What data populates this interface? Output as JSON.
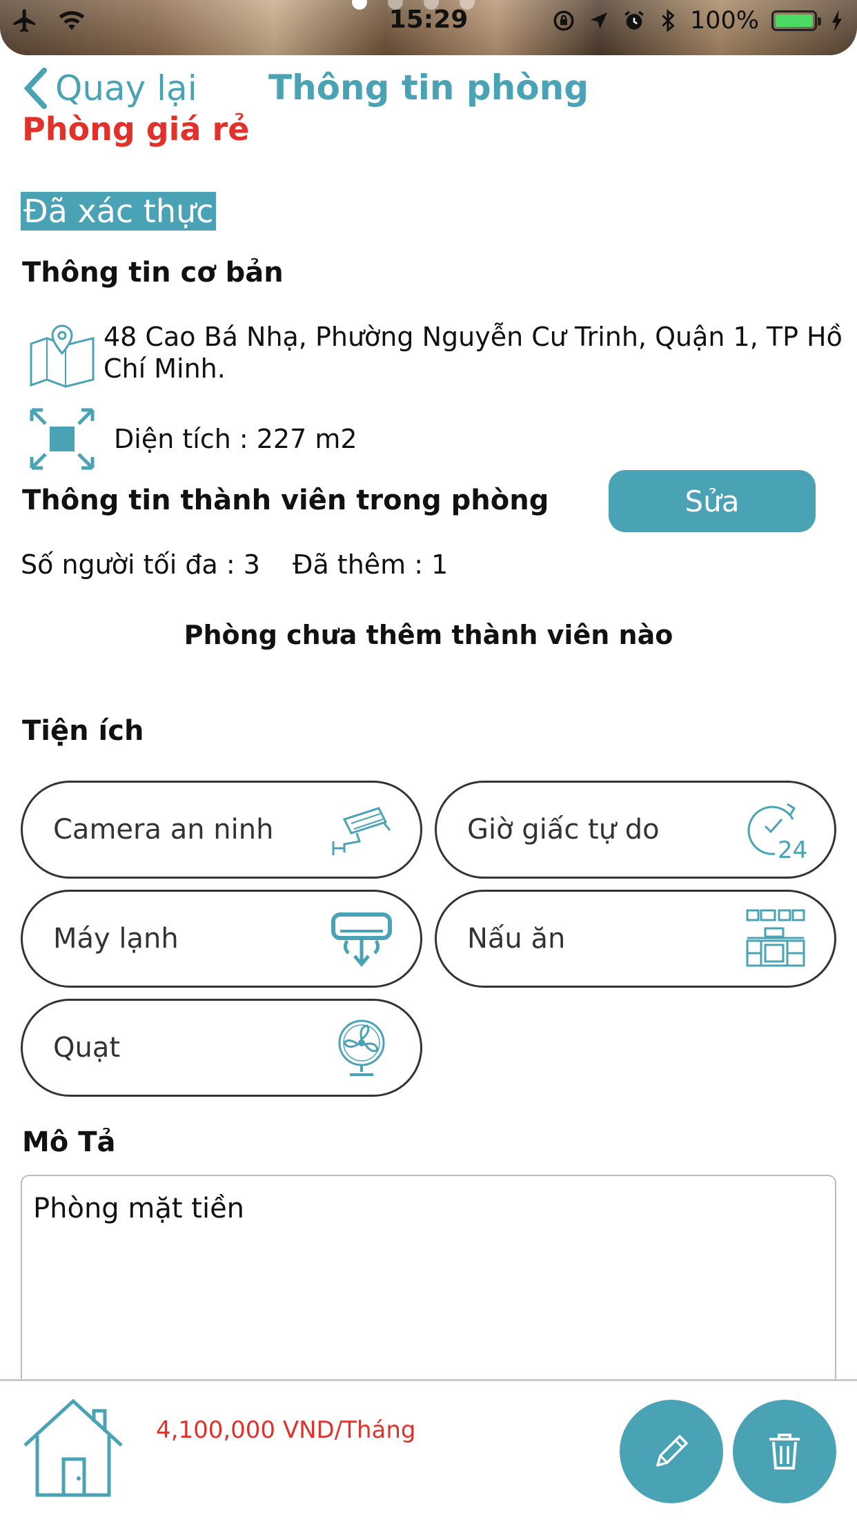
{
  "status_bar": {
    "time": "15:29",
    "battery_percent": "100%",
    "battery_level": 1.0
  },
  "nav": {
    "back_label": "Quay lại",
    "title": "Thông tin phòng"
  },
  "room": {
    "name": "Phòng giá rẻ",
    "verified_badge": "Đã xác thực"
  },
  "basic_info": {
    "heading": "Thông tin cơ bản",
    "address_line1": "48 Cao Bá Nhạ, Phường Nguyễn Cư Trinh, Quận 1, TP Hồ",
    "address_line2": "Chí Minh.",
    "area": "Diện tích : 227 m2"
  },
  "members": {
    "heading": "Thông tin thành viên trong phòng",
    "edit_label": "Sửa",
    "max_people": "Số người tối đa : 3",
    "added": "Đã thêm : 1",
    "empty_message": "Phòng chưa thêm thành viên nào"
  },
  "amenities": {
    "heading": "Tiện ích",
    "items": [
      {
        "label": "Camera an ninh",
        "icon": "security-camera-icon"
      },
      {
        "label": "Giờ giấc tự do",
        "icon": "clock-24-icon"
      },
      {
        "label": "Máy lạnh",
        "icon": "air-conditioner-icon"
      },
      {
        "label": "Nấu ăn",
        "icon": "kitchen-icon"
      },
      {
        "label": "Quạt",
        "icon": "fan-icon"
      }
    ]
  },
  "description": {
    "heading": "Mô Tả",
    "text": "Phòng mặt tiền"
  },
  "footer": {
    "price": "4,100,000 VND/Tháng"
  },
  "colors": {
    "accent": "#4aa3b5",
    "price_red": "#e2302a"
  }
}
